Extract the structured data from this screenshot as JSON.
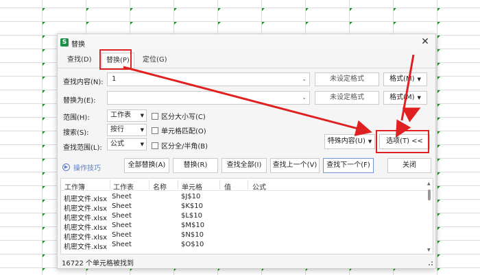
{
  "dialog": {
    "title": "替换",
    "app_icon_letter": "S",
    "tabs": [
      {
        "label": "查找(D)"
      },
      {
        "label": "替换(P)"
      },
      {
        "label": "定位(G)"
      }
    ],
    "find": {
      "label": "查找内容(N):",
      "value": "1",
      "format_placeholder": "未设定格式",
      "format_button": "格式(M)"
    },
    "replace": {
      "label": "替换为(E):",
      "value": "",
      "format_placeholder": "未设定格式",
      "format_button": "格式(M)"
    },
    "options": {
      "scope_label": "范围(H):",
      "scope_value": "工作表",
      "search_label": "搜索(S):",
      "search_value": "按行",
      "lookin_label": "查找范围(L):",
      "lookin_value": "公式",
      "match_case": "区分大小写(C)",
      "whole_cell": "单元格匹配(O)",
      "full_half": "区分全/半角(B)"
    },
    "special_button": "特殊内容(U)",
    "options_button": "选项(T) <<",
    "tips_link": "操作技巧",
    "actions": {
      "replace_all": "全部替换(A)",
      "replace": "替换(R)",
      "find_all": "查找全部(I)",
      "find_prev": "查找上一个(V)",
      "find_next": "查找下一个(F)",
      "close": "关闭"
    },
    "results": {
      "columns": [
        "工作簿",
        "工作表",
        "名称",
        "单元格",
        "值",
        "公式"
      ],
      "rows": [
        {
          "book": "机密文件.xlsx",
          "sheet": "Sheet",
          "cell": "$J$10"
        },
        {
          "book": "机密文件.xlsx",
          "sheet": "Sheet",
          "cell": "$K$10"
        },
        {
          "book": "机密文件.xlsx",
          "sheet": "Sheet",
          "cell": "$L$10"
        },
        {
          "book": "机密文件.xlsx",
          "sheet": "Sheet",
          "cell": "$M$10"
        },
        {
          "book": "机密文件.xlsx",
          "sheet": "Sheet",
          "cell": "$N$10"
        },
        {
          "book": "机密文件.xlsx",
          "sheet": "Sheet",
          "cell": "$O$10"
        }
      ]
    },
    "status": "16722 个单元格被找到"
  },
  "colors": {
    "accent": "#1e8f4a",
    "highlight": "#e02020",
    "link": "#5a7fc8"
  }
}
